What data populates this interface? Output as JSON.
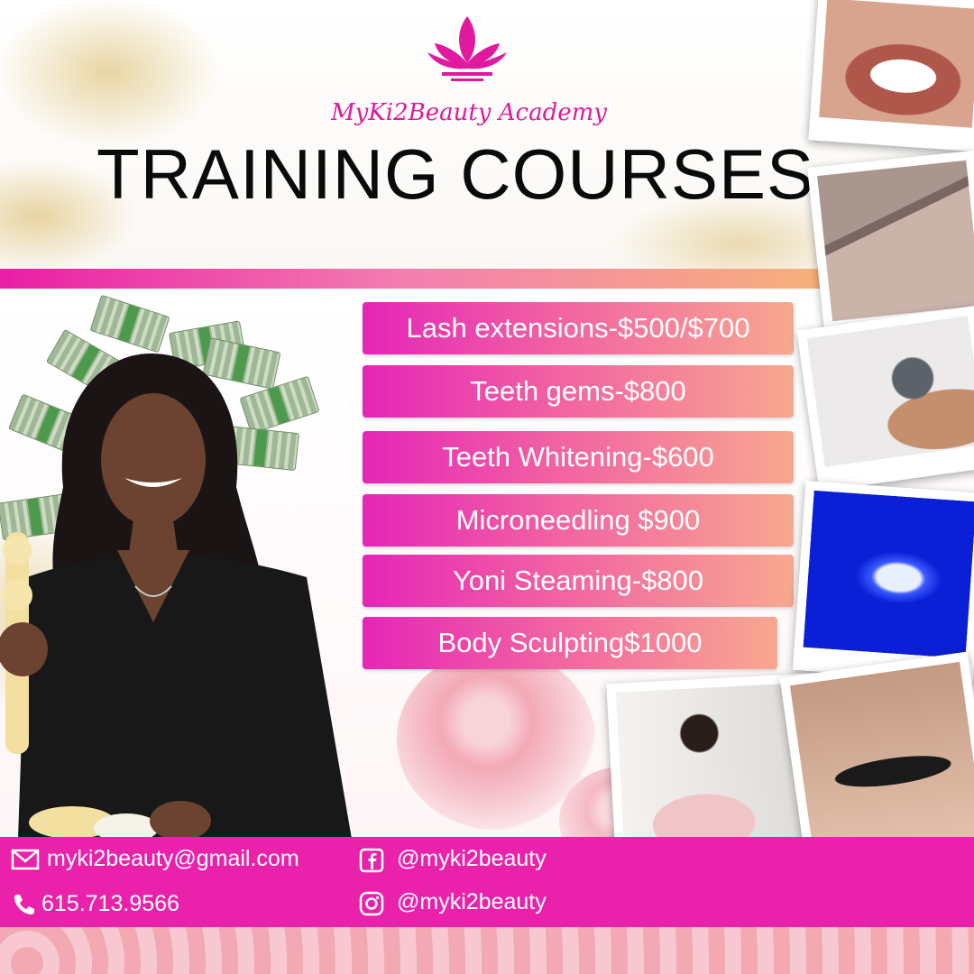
{
  "brand": "MyKi2Beauty Academy",
  "title": "TRAINING COURSES",
  "courses": [
    "Lash extensions-$500/$700",
    "Teeth gems-$800",
    "Teeth Whitening-$600",
    "Microneedling $900",
    "Yoni Steaming-$800",
    "Body Sculpting$1000"
  ],
  "contact": {
    "email": "myki2beauty@gmail.com",
    "phone": "615.713.9566",
    "facebook": "@myki2beauty",
    "instagram": "@myki2beauty"
  },
  "icons": [
    "lotus-logo",
    "mail-icon",
    "phone-icon",
    "facebook-icon",
    "instagram-icon"
  ],
  "colors": {
    "accent": "#e91ea6",
    "footer": "#ea22ab",
    "title": "#0a0a0a"
  }
}
